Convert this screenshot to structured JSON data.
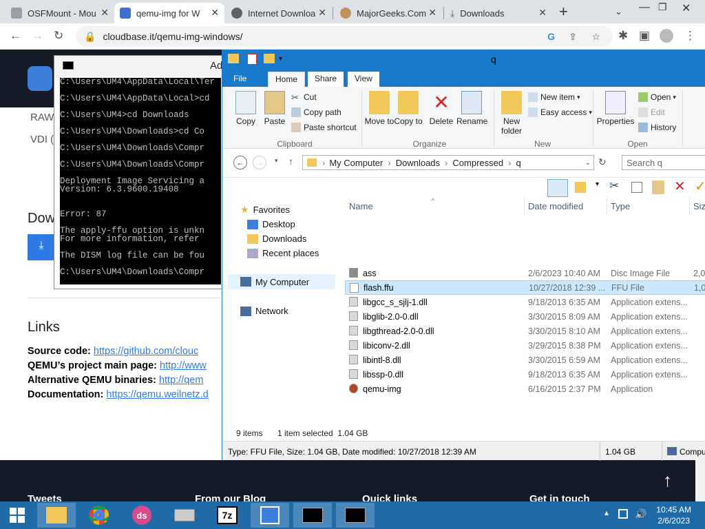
{
  "browser": {
    "tabs": [
      {
        "label": "OSFMount - Mou",
        "color": "#9aa0a6"
      },
      {
        "label": "qemu-img for W",
        "color": "#3b6fd1",
        "active": true
      },
      {
        "label": "Internet Downloa",
        "color": "#5f6368"
      },
      {
        "label": "MajorGeeks.Com",
        "color": "#c09060"
      },
      {
        "label": "Downloads",
        "color": "#5f6368"
      }
    ],
    "url": "cloudbase.it/qemu-img-windows/"
  },
  "webpage": {
    "side_items": [
      "RAW",
      "VDI (",
      "Dow"
    ],
    "links_title": "Links",
    "links": [
      {
        "label": "Source code:",
        "url": "https://github.com/clouc"
      },
      {
        "label": "QEMU’s project main page:",
        "url": "http://www"
      },
      {
        "label": "Alternative QEMU binaries:",
        "url": "http://qem"
      },
      {
        "label": "Documentation:",
        "url": "https://qemu.weilnetz.d"
      }
    ],
    "footer": [
      "Tweets",
      "From our Blog",
      "Quick links",
      "Get in touch"
    ]
  },
  "cmd": {
    "title": "Ad",
    "lines": [
      "C:\\Users\\UM4\\AppData\\Local\\Ter",
      "",
      "C:\\Users\\UM4\\AppData\\Local>cd",
      "",
      "C:\\Users\\UM4>cd Downloads",
      "",
      "C:\\Users\\UM4\\Downloads>cd Co",
      "",
      "C:\\Users\\UM4\\Downloads\\Compr",
      "",
      "C:\\Users\\UM4\\Downloads\\Compr",
      "",
      "Deployment Image Servicing a",
      "Version: 6.3.9600.19408",
      "",
      "",
      "Error: 87",
      "",
      "The apply-ffu option is unkn",
      "For more information, refer",
      "",
      "The DISM log file can be fou",
      "",
      "C:\\Users\\UM4\\Downloads\\Compr"
    ]
  },
  "explorer": {
    "title": "q",
    "tabs": [
      "File",
      "Home",
      "Share",
      "View"
    ],
    "ribbon": {
      "copy": "Copy",
      "paste": "Paste",
      "cut": "Cut",
      "copy_path": "Copy path",
      "paste_shortcut": "Paste shortcut",
      "move_to": "Move to",
      "copy_to": "Copy to",
      "delete": "Delete",
      "rename": "Rename",
      "new_folder": "New folder",
      "new_item": "New item",
      "easy_access": "Easy access",
      "properties": "Properties",
      "open": "Open",
      "edit": "Edit",
      "history": "History",
      "groups": [
        "Clipboard",
        "Organize",
        "New",
        "Open"
      ]
    },
    "breadcrumb": [
      "My Computer",
      "Downloads",
      "Compressed",
      "q"
    ],
    "search_placeholder": "Search q",
    "nav": {
      "favorites": "Favorites",
      "fav_items": [
        "Desktop",
        "Downloads",
        "Recent places"
      ],
      "my_computer": "My Computer",
      "network": "Network"
    },
    "columns": [
      "Name",
      "Date modified",
      "Type",
      "Size"
    ],
    "files": [
      {
        "name": "ass",
        "date": "2/6/2023 10:40 AM",
        "type": "Disc Image File",
        "size": "2,0"
      },
      {
        "name": "flash.ffu",
        "date": "10/27/2018 12:39 ...",
        "type": "FFU File",
        "size": "1,0",
        "selected": true
      },
      {
        "name": "libgcc_s_sjlj-1.dll",
        "date": "9/18/2013 6:35 AM",
        "type": "Application extens...",
        "size": ""
      },
      {
        "name": "libglib-2.0-0.dll",
        "date": "3/30/2015 8:09 AM",
        "type": "Application extens...",
        "size": ""
      },
      {
        "name": "libgthread-2.0-0.dll",
        "date": "3/30/2015 8:10 AM",
        "type": "Application extens...",
        "size": ""
      },
      {
        "name": "libiconv-2.dll",
        "date": "3/29/2015 8:38 PM",
        "type": "Application extens...",
        "size": ""
      },
      {
        "name": "libintl-8.dll",
        "date": "3/30/2015 6:59 AM",
        "type": "Application extens...",
        "size": ""
      },
      {
        "name": "libssp-0.dll",
        "date": "9/18/2013 6:35 AM",
        "type": "Application extens...",
        "size": ""
      },
      {
        "name": "qemu-img",
        "date": "6/16/2015 2:37 PM",
        "type": "Application",
        "size": ""
      }
    ],
    "status": {
      "count": "9 items",
      "selected": "1 item selected  1.04 GB"
    },
    "details": {
      "info": "Type: FFU File, Size: 1.04 GB, Date modified: 10/27/2018 12:39 AM",
      "size": "1.04 GB",
      "location": "Compu"
    }
  },
  "taskbar": {
    "time": "10:45 AM",
    "date": "2/6/2023"
  }
}
